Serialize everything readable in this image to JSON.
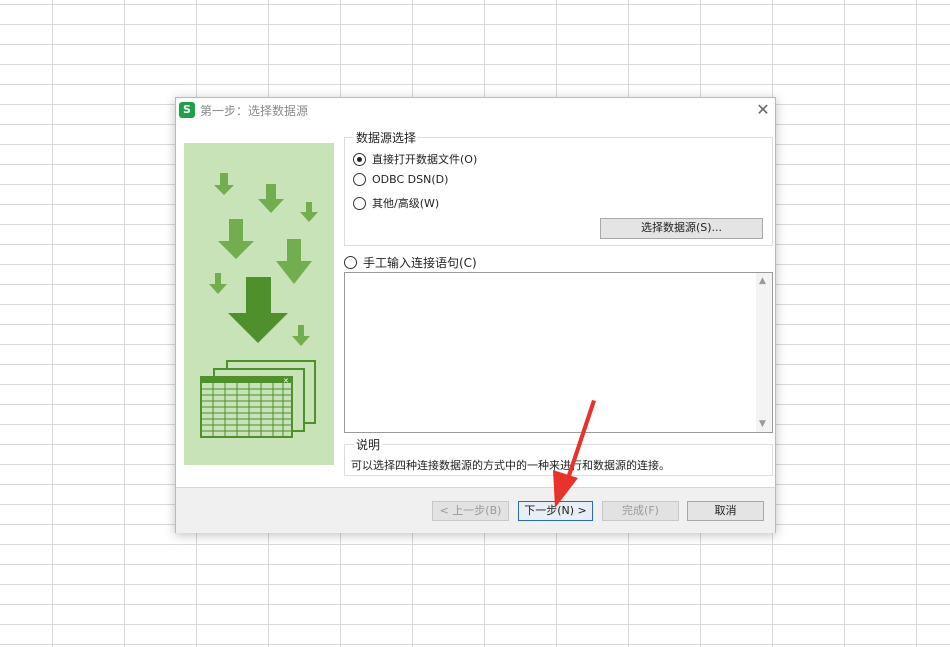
{
  "dialog": {
    "title": "第一步：选择数据源",
    "app_icon_letter": "S",
    "close_glyph": "✕"
  },
  "source_group": {
    "legend": "数据源选择",
    "options": [
      {
        "label": "直接打开数据文件(O)",
        "selected": true
      },
      {
        "label": "ODBC DSN(D)",
        "selected": false
      },
      {
        "label": "其他/高级(W)",
        "selected": false
      }
    ],
    "select_button": "选择数据源(S)..."
  },
  "manual_option": {
    "label": "手工输入连接语句(C)",
    "selected": false
  },
  "connection_text": {
    "value": ""
  },
  "description": {
    "legend": "说明",
    "text": "可以选择四种连接数据源的方式中的一种来进行和数据源的连接。"
  },
  "footer": {
    "prev": "< 上一步(B)",
    "next": "下一步(N) >",
    "finish": "完成(F)",
    "cancel": "取消"
  },
  "colors": {
    "illustration_bg": "#c9e3b8",
    "arrow_green": "#5a9a3a",
    "annotation_red": "#e8322c"
  },
  "icons": [
    "spreadsheet-app-icon",
    "close-icon",
    "download-arrows-illustration",
    "radio-icon",
    "scroll-up-icon",
    "scroll-down-icon",
    "red-pointer-arrow"
  ]
}
